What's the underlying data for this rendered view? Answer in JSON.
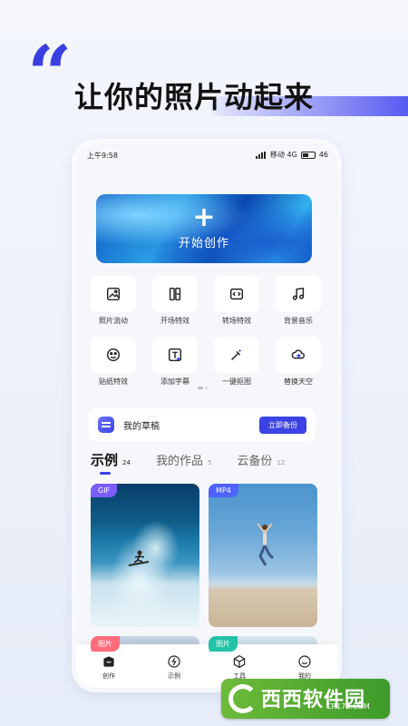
{
  "promo": {
    "quote_mark": "“",
    "headline": "让你的照片动起来"
  },
  "status_bar": {
    "time": "上午9:58",
    "carrier": "移动 4G",
    "battery": "46"
  },
  "banner": {
    "icon": "plus-icon",
    "label": "开始创作"
  },
  "tools": [
    {
      "label": "照片流动",
      "icon": "image-icon"
    },
    {
      "label": "开场特效",
      "icon": "opening-effect-icon"
    },
    {
      "label": "转场特效",
      "icon": "transition-icon"
    },
    {
      "label": "背景音乐",
      "icon": "music-note-icon"
    },
    {
      "label": "贴纸特效",
      "icon": "sticker-icon"
    },
    {
      "label": "添加字幕",
      "icon": "text-add-icon"
    },
    {
      "label": "一键抠图",
      "icon": "magic-wand-icon"
    },
    {
      "label": "替换天空",
      "icon": "cloud-icon"
    }
  ],
  "draft": {
    "title": "我的草稿",
    "button": "立即备份"
  },
  "tabs": [
    {
      "label": "示例",
      "count": "24",
      "active": true
    },
    {
      "label": "我的作品",
      "count": "5",
      "active": false
    },
    {
      "label": "云备份",
      "count": "12",
      "active": false
    }
  ],
  "cards": [
    {
      "badge": "GIF",
      "badge_color": "#7b5cff"
    },
    {
      "badge": "MP4",
      "badge_color": "#4e63ff"
    },
    {
      "badge": "图片",
      "badge_color": "#ff6a7a"
    },
    {
      "badge": "图片",
      "badge_color": "#22c3a6"
    }
  ],
  "bottom_nav": [
    {
      "label": "创作",
      "icon": "create-icon"
    },
    {
      "label": "示例",
      "icon": "lightning-icon"
    },
    {
      "label": "工具",
      "icon": "box-icon"
    },
    {
      "label": "我的",
      "icon": "smile-icon"
    }
  ],
  "watermark": {
    "brand": "西西软件园",
    "url": "CR173.COM"
  },
  "colors": {
    "accent": "#3b43e4",
    "headline": "#111111"
  }
}
